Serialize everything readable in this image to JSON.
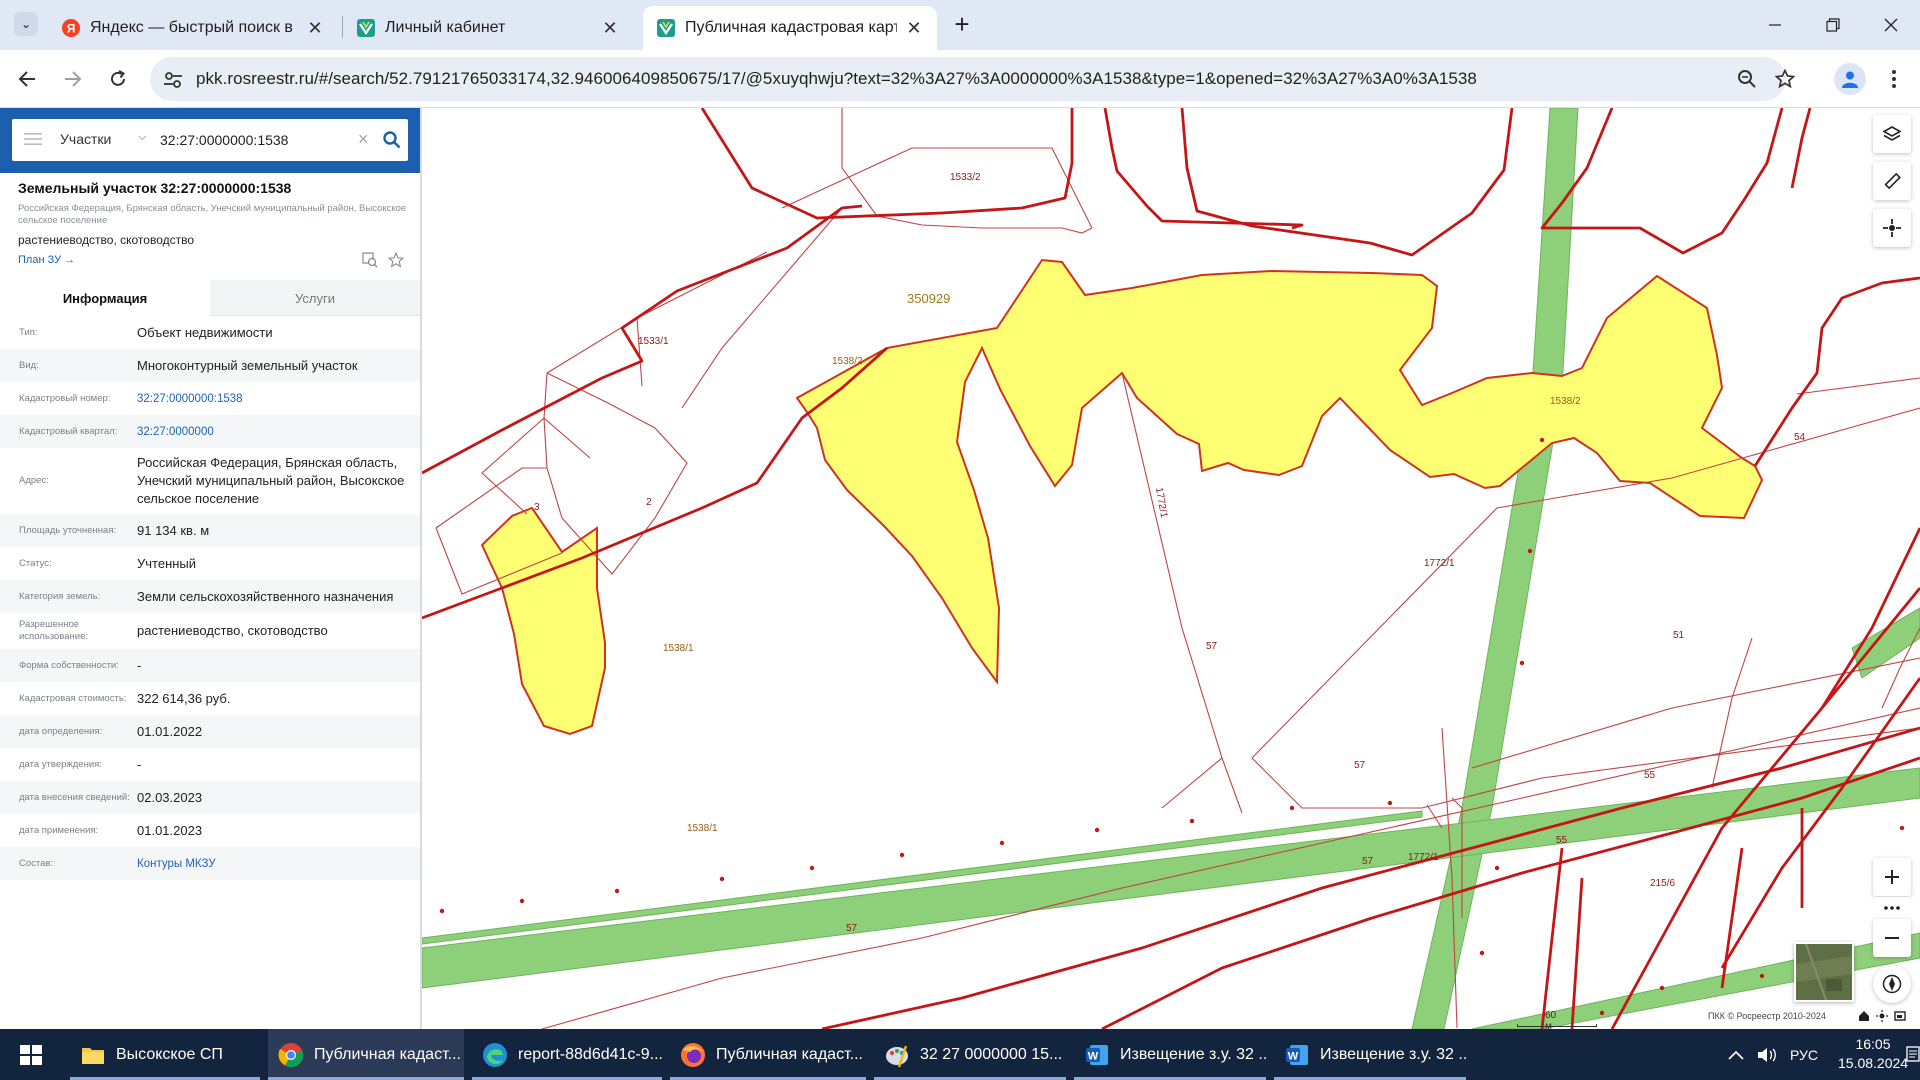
{
  "browser": {
    "tabs": [
      {
        "title": "Яндекс — быстрый поиск в интернете",
        "icon": "yandex-icon"
      },
      {
        "title": "Личный кабинет",
        "icon": "rosreestr-icon"
      },
      {
        "title": "Публичная кадастровая карта",
        "icon": "rosreestr-icon",
        "active": true
      }
    ],
    "url": "pkk.rosreestr.ru/#/search/52.79121765033174,32.946006409850675/17/@5xuyqhwju?text=32%3A27%3A0000000%3A1538&type=1&opened=32%3A27%3A0%3A1538"
  },
  "sidebar": {
    "search": {
      "category": "Участки",
      "query": "32:27:0000000:1538"
    },
    "parcel": {
      "title": "Земельный участок 32:27:0000000:1538",
      "subtitle": "Российская Федерация, Брянская область, Унечский муниципальный район, Высокское сельское поселение",
      "use": "растениеводство, скотоводство",
      "plan_link": "План ЗУ →"
    },
    "tabs": {
      "info": "Информация",
      "services": "Услуги"
    },
    "properties": [
      {
        "label": "Тип:",
        "value": "Объект недвижимости"
      },
      {
        "label": "Вид:",
        "value": "Многоконтурный земельный участок"
      },
      {
        "label": "Кадастровый номер:",
        "value": "32:27:0000000:1538",
        "link": true
      },
      {
        "label": "Кадастровый квартал:",
        "value": "32:27:0000000",
        "link": true
      },
      {
        "label": "Адрес:",
        "value": "Российская Федерация, Брянская область, Унечский муниципальный район, Высокское сельское поселение"
      },
      {
        "label": "Площадь уточненная:",
        "value": "91 134 кв. м"
      },
      {
        "label": "Статус:",
        "value": "Учтенный"
      },
      {
        "label": "Категория земель:",
        "value": "Земли сельскохозяйственного назначения"
      },
      {
        "label": "Разрешенное использование:",
        "value": "растениеводство, скотоводство"
      },
      {
        "label": "Форма собственности:",
        "value": "-"
      },
      {
        "label": "Кадастровая стоимость:",
        "value": "322 614,36 руб."
      },
      {
        "label": "дата определения:",
        "value": "01.01.2022"
      },
      {
        "label": "дата утверждения:",
        "value": "-"
      },
      {
        "label": "дата внесения сведений:",
        "value": "02.03.2023"
      },
      {
        "label": "дата применения:",
        "value": "01.01.2023"
      },
      {
        "label": "Состав:",
        "value": "Контуры МКЗУ",
        "link": true
      }
    ]
  },
  "map": {
    "labels": {
      "l1533_2": "1533/2",
      "l350929": "350929",
      "l1533_1": "1533/1",
      "l1538_2a": "1538/2",
      "l1538_2b": "1538/2",
      "l54": "54",
      "l1772_1v": "1772/1",
      "l3": "3",
      "l2": "2",
      "l1772_1": "1772/1",
      "l51": "51",
      "l57a": "57",
      "l1538_1a": "1538/1",
      "l57b": "57",
      "l55a": "55",
      "l1538_1b": "1538/1",
      "l55b": "55",
      "l57c": "57",
      "l1772_1b": "1772/1",
      "l215_6": "215/6",
      "l57d": "57"
    },
    "scale": "60 м",
    "copyright": "ПКК © Росреестр 2010-2024",
    "colors": {
      "parcel_fill": "#ffff74",
      "parcel_stroke": "#c0392b",
      "boundary": "#c41616",
      "green": "#8ecf79"
    }
  },
  "taskbar": {
    "items": [
      {
        "label": "Высокское СП",
        "icon": "folder-icon"
      },
      {
        "label": "Публичная кадаст...",
        "icon": "chrome-icon",
        "active": true
      },
      {
        "label": "report-88d6d41c-9...",
        "icon": "edge-icon"
      },
      {
        "label": "Публичная кадаст...",
        "icon": "firefox-icon"
      },
      {
        "label": "32  27  0000000  15...",
        "icon": "paint-icon"
      },
      {
        "label": "Извещение з.у. 32 ...",
        "icon": "word-icon"
      },
      {
        "label": "Извещение з.у. 32 ...",
        "icon": "word-icon"
      }
    ],
    "lang": "РУС",
    "time": "16:05",
    "date": "15.08.2024"
  }
}
